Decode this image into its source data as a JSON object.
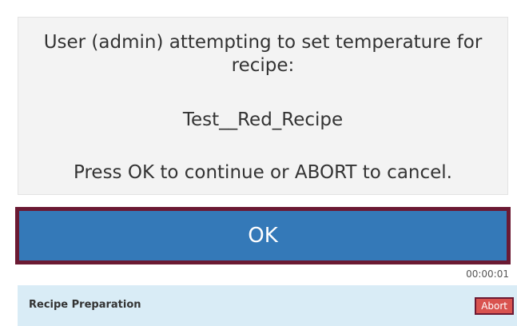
{
  "dialog": {
    "message_line": "User (admin) attempting to set temperature for recipe:",
    "recipe_name": "Test__Red_Recipe",
    "instruction": "Press OK to continue or ABORT to cancel."
  },
  "ok_button": {
    "label": "OK"
  },
  "timer": {
    "elapsed": "00:00:01"
  },
  "footer": {
    "title": "Recipe Preparation",
    "abort_label": "Abort"
  },
  "colors": {
    "ok_button_bg": "#3479b8",
    "focus_border": "#6b1a33",
    "abort_bg": "#d9534f",
    "footer_bg": "#d9ecf6",
    "message_bg": "#f3f3f3"
  }
}
